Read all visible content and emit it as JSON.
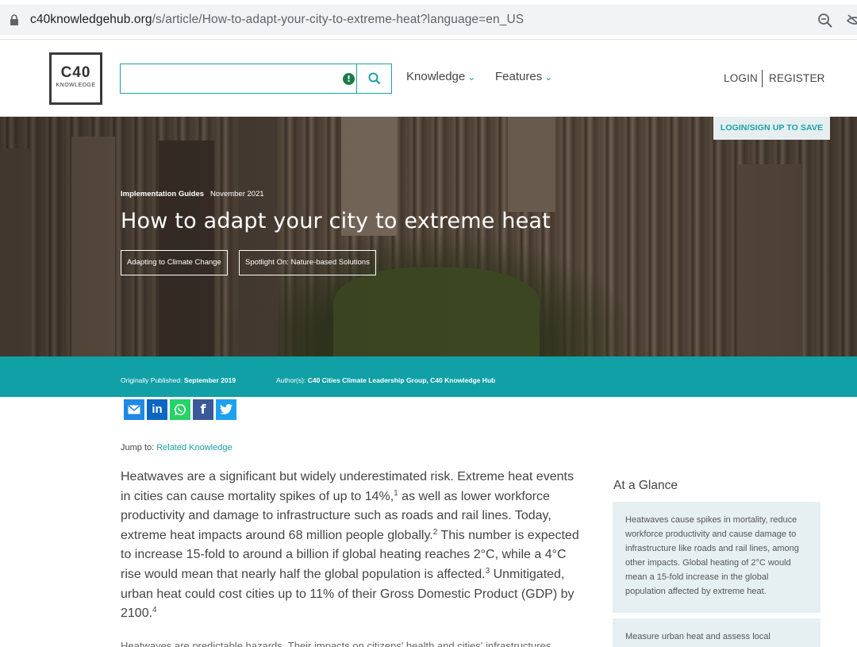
{
  "browser": {
    "url_host": "c40knowledgehub.org",
    "url_path": "/s/article/How-to-adapt-your-city-to-extreme-heat?language=en_US"
  },
  "header": {
    "logo_main": "C40",
    "logo_sub": "KNOWLEDGE",
    "search_placeholder": "",
    "info_glyph": "!",
    "nav": [
      "Knowledge",
      "Features"
    ],
    "login": "LOGIN",
    "register": "REGISTER"
  },
  "hero": {
    "save_label": "LOGIN/SIGN UP TO SAVE",
    "category": "Implementation Guides",
    "date": "November 2021",
    "title": "How to adapt your city to extreme heat",
    "tags": [
      "Adapting to Climate Change",
      "Spotlight On: Nature-based Solutions"
    ]
  },
  "meta_bar": {
    "published_label": "Originally Published:",
    "published_value": "September 2019",
    "authors_label": "Author(s):",
    "authors_value": "C40 Cities Climate Leadership Group, C40 Knowledge Hub"
  },
  "share": {
    "icons": [
      "email-icon",
      "linkedin-icon",
      "whatsapp-icon",
      "facebook-icon",
      "twitter-icon"
    ],
    "colors": [
      "#1e88e5",
      "#0a66c2",
      "#25d366",
      "#3b5998",
      "#1da1f2"
    ]
  },
  "jump": {
    "label": "Jump to:",
    "link": "Related Knowledge"
  },
  "article": {
    "p1_a": "Heatwaves are a significant but widely underestimated risk. Extreme heat events in cities can cause mortality spikes of up to 14%,",
    "sup1": "1",
    "p1_b": " as well as lower workforce productivity and damage to infrastructure such as roads and rail lines. Today, extreme heat impacts around 68 million people globally.",
    "sup2": "2",
    "p1_c": " This number is expected to increase 15-fold to around a billion if global heating reaches 2°C, while a 4°C rise would mean that nearly half the global population is affected.",
    "sup3": "3",
    "p1_d": " Unmitigated, urban heat could cost cities up to 11% of their Gross Domestic Product (GDP) by 2100.",
    "sup4": "4",
    "p2": "Heatwaves are predictable hazards. Their impacts on citizens' health and cities' infrastructures"
  },
  "glance": {
    "title": "At a Glance",
    "items": [
      "Heatwaves cause spikes in mortality, reduce workforce productivity and cause damage to infrastructure like roads and rail lines, among other impacts. Global heating of 2°C would mean a 15-fold increase in the global population affected by extreme heat.",
      "Measure urban heat and assess local"
    ]
  },
  "colors": {
    "teal": "#10a0a6",
    "glance_bg": "#e6f0f3"
  }
}
